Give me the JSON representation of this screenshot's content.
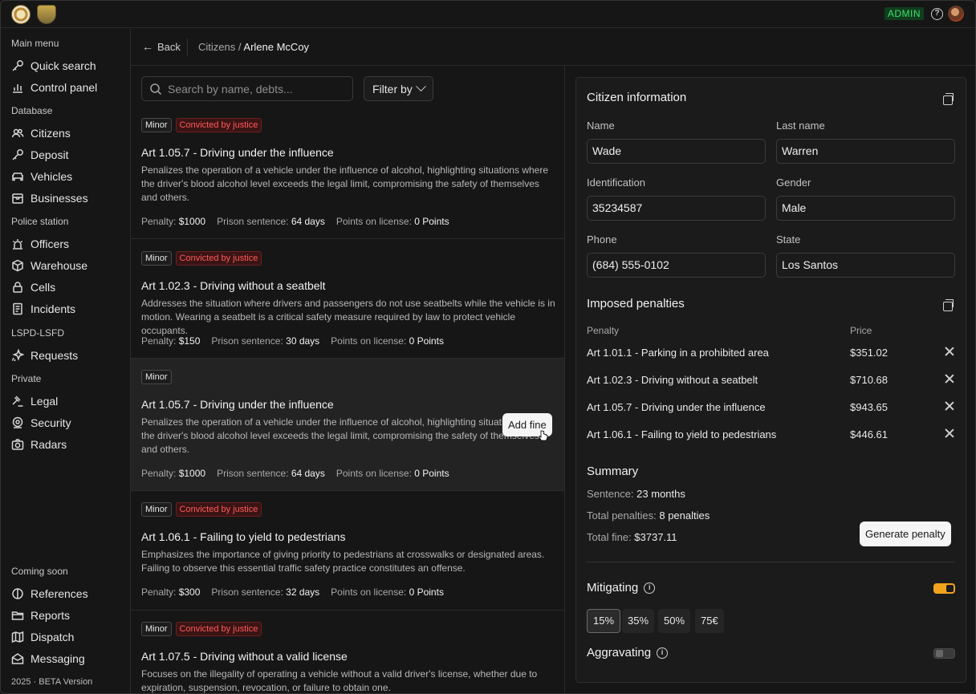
{
  "topbar": {
    "admin_label": "ADMIN",
    "help_icon": "help-circle-icon"
  },
  "sidebar": {
    "main_menu_label": "Main menu",
    "main_menu": [
      {
        "label": "Quick search",
        "icon": "key-icon"
      },
      {
        "label": "Control panel",
        "icon": "bar-chart-icon"
      }
    ],
    "database_label": "Database",
    "database": [
      {
        "label": "Citizens",
        "icon": "users-icon"
      },
      {
        "label": "Deposit",
        "icon": "key-icon"
      },
      {
        "label": "Vehicles",
        "icon": "car-icon"
      },
      {
        "label": "Businesses",
        "icon": "store-icon"
      }
    ],
    "police_label": "Police station",
    "police": [
      {
        "label": "Officers",
        "icon": "siren-icon"
      },
      {
        "label": "Warehouse",
        "icon": "box-icon"
      },
      {
        "label": "Cells",
        "icon": "lock-icon"
      },
      {
        "label": "Incidents",
        "icon": "document-icon"
      }
    ],
    "lspd_label": "LSPD-LSFD",
    "lspd": [
      {
        "label": "Requests",
        "icon": "sparkle-icon"
      }
    ],
    "private_label": "Private",
    "private": [
      {
        "label": "Legal",
        "icon": "gavel-icon"
      },
      {
        "label": "Security",
        "icon": "target-icon"
      },
      {
        "label": "Radars",
        "icon": "camera-icon"
      }
    ],
    "soon_label": "Coming soon",
    "soon": [
      {
        "label": "References",
        "icon": "half-circle-icon"
      },
      {
        "label": "Reports",
        "icon": "folder-icon"
      },
      {
        "label": "Dispatch",
        "icon": "map-icon"
      },
      {
        "label": "Messaging",
        "icon": "mail-icon"
      }
    ],
    "version": "2025 · BETA Version"
  },
  "header": {
    "back_label": "Back",
    "breadcrumb_parent": "Citizens",
    "breadcrumb_sep": "/",
    "breadcrumb_current": "Arlene McCoy"
  },
  "list": {
    "search_placeholder": "Search by name, debts...",
    "filter_label": "Filter by",
    "add_fine_label": "Add fine",
    "penalty_label": "Penalty:",
    "prison_label": "Prison sentence:",
    "points_label": "Points on license:",
    "items": [
      {
        "badge": "Minor",
        "status": "Convicted by justice",
        "title": "Art 1.05.7 - Driving under the influence",
        "desc": "Penalizes the operation of a vehicle under the influence of alcohol, highlighting situations where the driver's blood alcohol level exceeds the legal limit, compromising the safety of themselves and others.",
        "penalty": "$1000",
        "prison": "64 days",
        "points": "0 Points"
      },
      {
        "badge": "Minor",
        "status": "Convicted by justice",
        "title": "Art 1.02.3 - Driving without a seatbelt",
        "desc": "Addresses the situation where drivers and passengers do not use seatbelts while the vehicle is in motion. Wearing a seatbelt is a critical safety measure required by law to protect vehicle occupants.",
        "penalty": "$150",
        "prison": "30 days",
        "points": "0 Points"
      },
      {
        "badge": "Minor",
        "status": "",
        "title": "Art 1.05.7 - Driving under the influence",
        "desc": "Penalizes the operation of a vehicle under the influence of alcohol, highlighting situations where the driver's blood alcohol level exceeds the legal limit, compromising the safety of themselves and others.",
        "penalty": "$1000",
        "prison": "64 days",
        "points": "0 Points"
      },
      {
        "badge": "Minor",
        "status": "Convicted by justice",
        "title": "Art 1.06.1 - Failing to yield to pedestrians",
        "desc": "Emphasizes the importance of giving priority to pedestrians at crosswalks or designated areas. Failing to observe this essential traffic safety practice constitutes an offense.",
        "penalty": "$300",
        "prison": "32 days",
        "points": "0 Points"
      },
      {
        "badge": "Minor",
        "status": "Convicted by justice",
        "title": "Art 1.07.5 - Driving without a valid license",
        "desc": "Focuses on the illegality of operating a vehicle without a valid driver's license, whether due to expiration, suspension, revocation, or failure to obtain one.",
        "penalty": "",
        "prison": "",
        "points": ""
      }
    ]
  },
  "citizen": {
    "title": "Citizen information",
    "name_label": "Name",
    "name": "Wade",
    "last_label": "Last name",
    "last": "Warren",
    "id_label": "Identification",
    "id": "35234587",
    "gender_label": "Gender",
    "gender": "Male",
    "phone_label": "Phone",
    "phone": "(684) 555-0102",
    "state_label": "State",
    "state": "Los Santos"
  },
  "penalties": {
    "title": "Imposed penalties",
    "col_penalty": "Penalty",
    "col_price": "Price",
    "rows": [
      {
        "name": "Art 1.01.1 - Parking in a prohibited area",
        "price": "$351.02"
      },
      {
        "name": "Art 1.02.3 - Driving without a seatbelt",
        "price": "$710.68"
      },
      {
        "name": "Art 1.05.7 - Driving under the influence",
        "price": "$943.65"
      },
      {
        "name": "Art 1.06.1 - Failing to yield to pedestrians",
        "price": "$446.61"
      }
    ]
  },
  "summary": {
    "title": "Summary",
    "sentence_label": "Sentence:",
    "sentence": "23 months",
    "total_pen_label": "Total penalties:",
    "total_pen": "8 penalties",
    "total_fine_label": "Total fine:",
    "total_fine": "$3737.11",
    "generate_label": "Generate penalty"
  },
  "mitigating": {
    "title": "Mitigating",
    "enabled": true,
    "options": [
      "15%",
      "35%",
      "50%",
      "75€"
    ],
    "selected": "15%"
  },
  "aggravating": {
    "title": "Aggravating",
    "enabled": false
  },
  "colors": {
    "accent": "#f2a31e",
    "admin_green": "#3ee06b",
    "convicted_red": "#ff5a5a"
  }
}
